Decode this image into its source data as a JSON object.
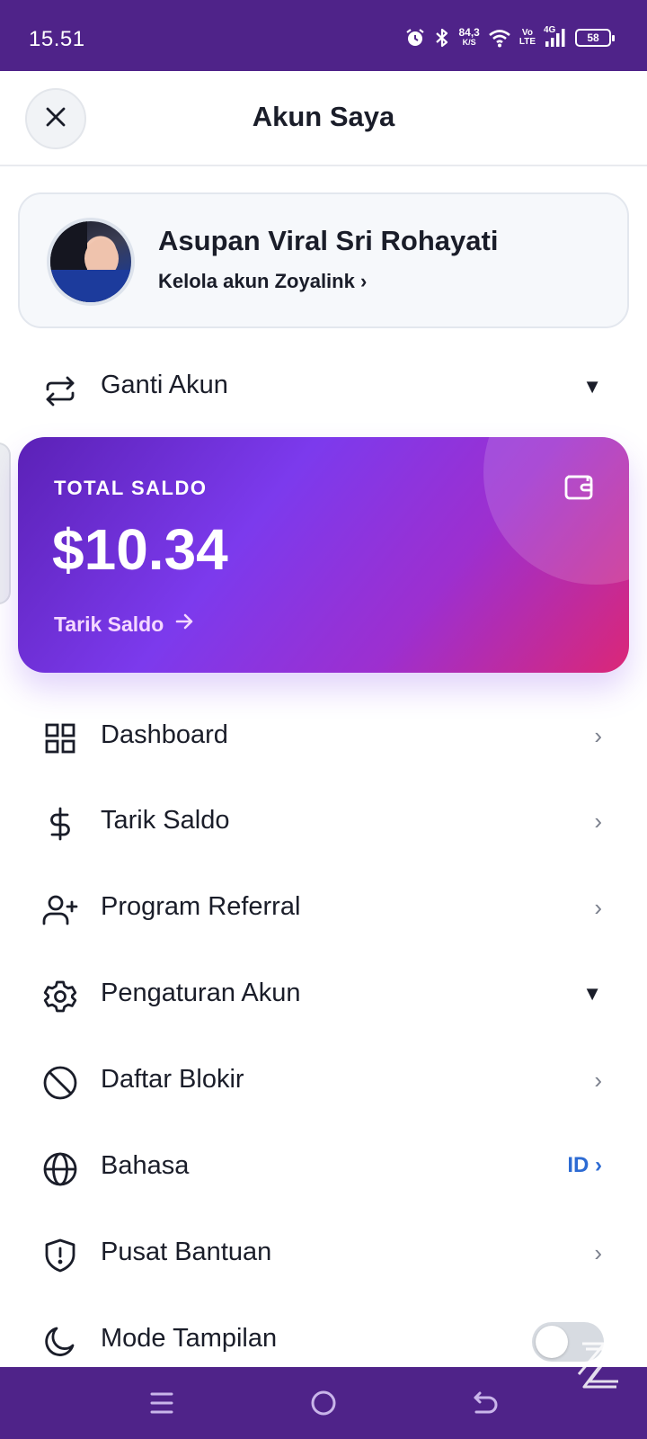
{
  "status_bar": {
    "time": "15.51",
    "speed_value": "84,3",
    "speed_unit": "K/S",
    "volte_top": "Vo",
    "volte_bottom": "LTE",
    "network": "4G",
    "battery": "58",
    "icons": [
      "alarm-icon",
      "bluetooth-icon",
      "wifi-icon",
      "signal-icon",
      "battery-icon"
    ]
  },
  "header": {
    "title": "Akun Saya",
    "close_icon": "close-icon"
  },
  "profile": {
    "name": "Asupan Viral Sri Rohayati",
    "manage_link": "Kelola akun Zoyalink ›"
  },
  "switch_account": {
    "label": "Ganti Akun",
    "icon": "swap-icon",
    "caret": "▼"
  },
  "balance": {
    "label": "TOTAL SALDO",
    "amount": "$10.34",
    "withdraw": "Tarik Saldo",
    "arrow": "→",
    "icon": "wallet-icon"
  },
  "menu": [
    {
      "label": "Dashboard",
      "icon": "grid-icon",
      "trailing": "›"
    },
    {
      "label": "Tarik Saldo",
      "icon": "dollar-icon",
      "trailing": "›"
    },
    {
      "label": "Program Referral",
      "icon": "user-plus-icon",
      "trailing": "›"
    },
    {
      "label": "Pengaturan Akun",
      "icon": "settings-icon",
      "trailing": "▼"
    },
    {
      "label": "Daftar Blokir",
      "icon": "block-icon",
      "trailing": "›"
    },
    {
      "label": "Bahasa",
      "icon": "globe-icon",
      "trailing": "ID ›"
    },
    {
      "label": "Pusat Bantuan",
      "icon": "shield-icon",
      "trailing": "›"
    },
    {
      "label": "Mode Tampilan",
      "icon": "moon-icon",
      "toggle_on": false
    }
  ],
  "colors": {
    "status_bar": "#4f2389",
    "card_gradient_start": "#5b21b6",
    "card_gradient_mid": "#7c3aed",
    "card_gradient_end": "#db2777",
    "language_accent": "#2d6bd3"
  }
}
